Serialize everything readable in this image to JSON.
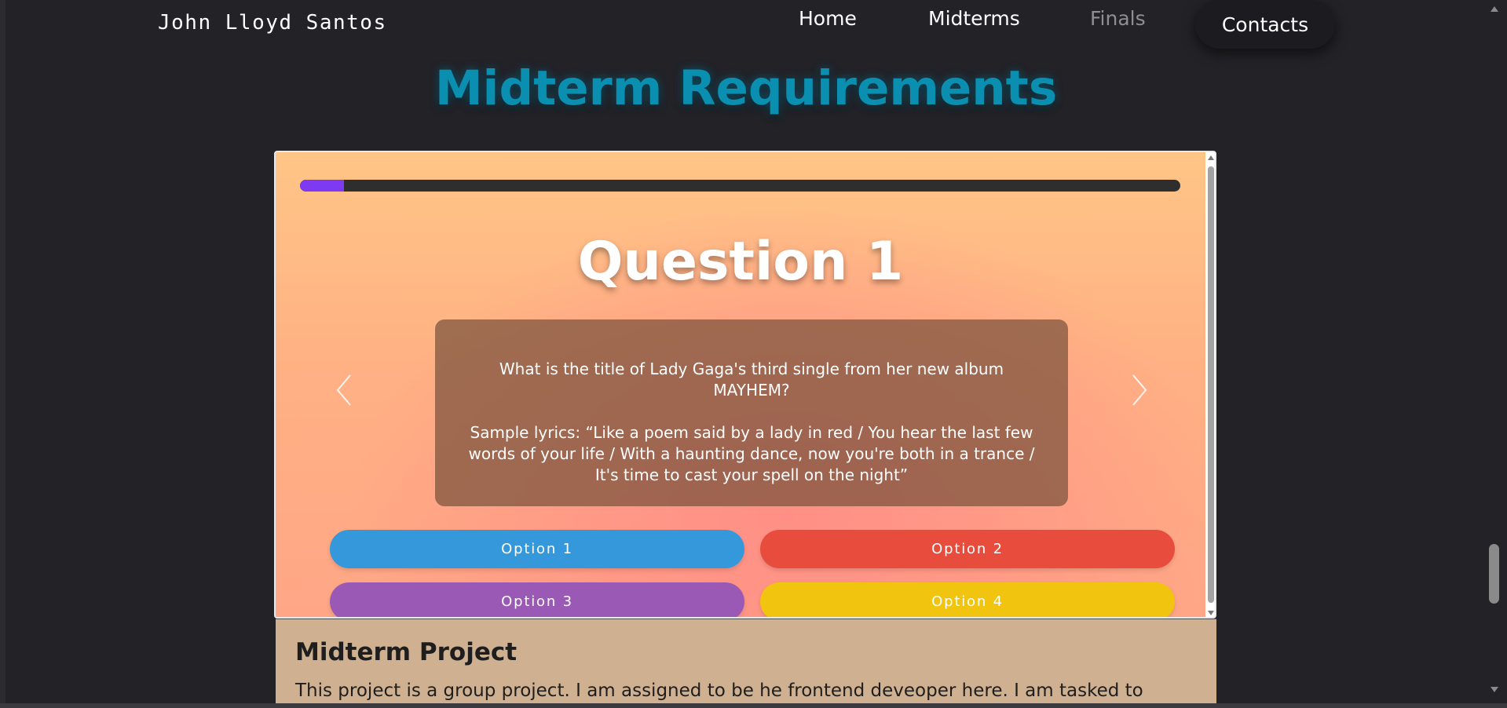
{
  "header": {
    "brand": "John Lloyd Santos",
    "nav": {
      "home": "Home",
      "midterms": "Midterms",
      "finals": "Finals",
      "contacts": "Contacts"
    }
  },
  "page_title": "Midterm Requirements",
  "quiz": {
    "progress_fraction": 0.05,
    "question_title": "Question 1",
    "question_text": "What is the title of Lady Gaga's third single from her new album MAYHEM?",
    "sample_lyrics": "Sample lyrics: “Like a poem said by a lady in red / You hear the last few words of your life / With a haunting dance, now you're both in a trance / It's time to cast your spell on the night”",
    "options": [
      {
        "label": "Option 1",
        "color": "#3498db"
      },
      {
        "label": "Option 2",
        "color": "#e74c3c"
      },
      {
        "label": "Option 3",
        "color": "#9b59b6"
      },
      {
        "label": "Option 4",
        "color": "#f1c40f"
      }
    ],
    "prev_icon": "chevron-left-icon",
    "next_icon": "chevron-right-icon"
  },
  "project": {
    "title": "Midterm Project",
    "text": "This project is a group project. I am assigned to be he frontend deveoper here. I am tasked to"
  },
  "colors": {
    "background": "#222227",
    "title_accent": "#0b8fb0",
    "progress_fill": "#7e3af2",
    "card_background": "#cfb090"
  }
}
